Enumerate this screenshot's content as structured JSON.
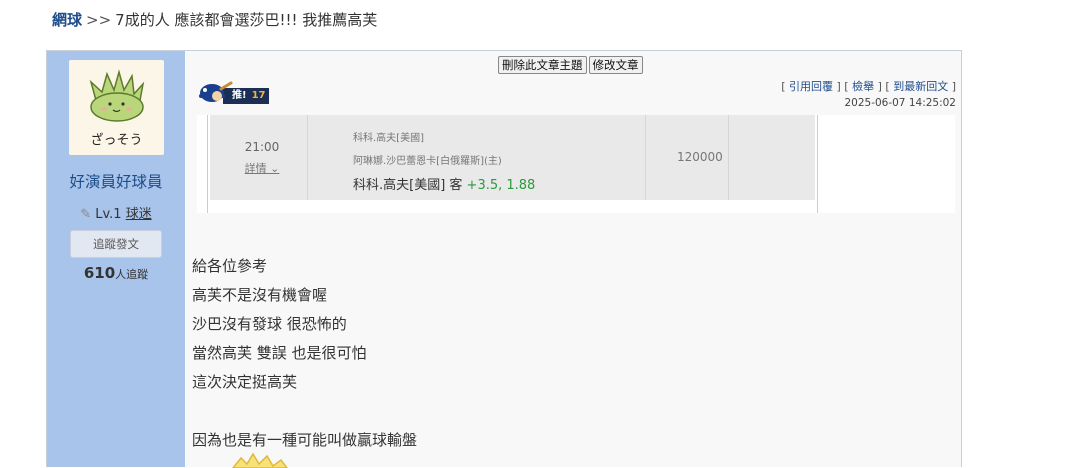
{
  "breadcrumb": {
    "forum": "網球",
    "separator": ">>",
    "title": "7成的人 應該都會選莎巴!!! 我推薦高芙"
  },
  "user": {
    "avatar_text": "ざっそう",
    "name": "好演員好球員",
    "level": "Lv.1",
    "rank": "球迷",
    "follow_label": "追蹤發文",
    "followers_count": "610",
    "followers_suffix": "人追蹤"
  },
  "actions": {
    "delete_label": "刪除此文章主題",
    "edit_label": "修改文章"
  },
  "push": {
    "label": "推!",
    "count": "17"
  },
  "links": {
    "open1": "[ ",
    "quote": "引用回覆",
    "close1": " ]",
    "open2": " [ ",
    "report": "檢舉",
    "close2": " ]",
    "open3": " [ ",
    "latest": "到最新回文",
    "close3": " ]"
  },
  "post_date": "2025-06-07 14:25:02",
  "bet": {
    "time": "21:00",
    "detail_label": "詳情",
    "league": "科科.高夫[美國]",
    "matchup": "阿琳娜.沙巴蕾恩卡[白俄羅斯](主)",
    "pick_text": "科科.高夫[美國] 客 ",
    "pick_odds": "+3.5, 1.88",
    "amount": "120000"
  },
  "body_lines": [
    "給各位參考",
    "高芙不是沒有機會喔",
    "沙巴沒有發球 很恐怖的",
    "當然高芙 雙誤 也是很可怕",
    "這次決定挺高芙",
    "",
    "因為也是有一種可能叫做贏球輸盤"
  ],
  "colors": {
    "sidebar": "#a9c4ea",
    "link": "#1f4e8c",
    "odds": "#2b9a3c",
    "badge": "#1b2e55"
  }
}
